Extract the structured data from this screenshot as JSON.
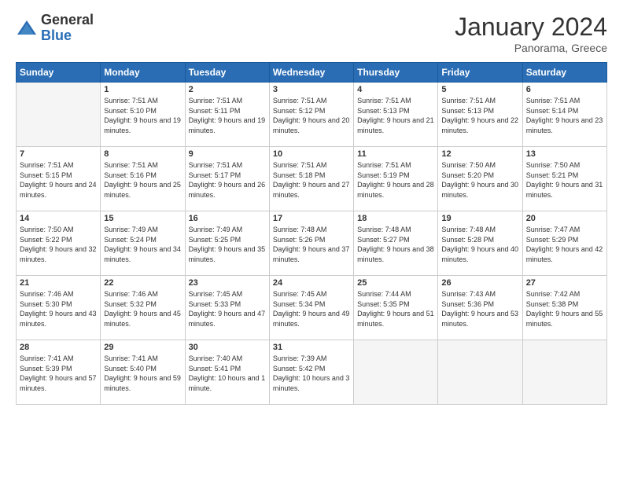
{
  "logo": {
    "general": "General",
    "blue": "Blue"
  },
  "header": {
    "title": "January 2024",
    "subtitle": "Panorama, Greece"
  },
  "days_of_week": [
    "Sunday",
    "Monday",
    "Tuesday",
    "Wednesday",
    "Thursday",
    "Friday",
    "Saturday"
  ],
  "weeks": [
    [
      {
        "day": "",
        "sunrise": "",
        "sunset": "",
        "daylight": "",
        "empty": true
      },
      {
        "day": "1",
        "sunrise": "Sunrise: 7:51 AM",
        "sunset": "Sunset: 5:10 PM",
        "daylight": "Daylight: 9 hours and 19 minutes."
      },
      {
        "day": "2",
        "sunrise": "Sunrise: 7:51 AM",
        "sunset": "Sunset: 5:11 PM",
        "daylight": "Daylight: 9 hours and 19 minutes."
      },
      {
        "day": "3",
        "sunrise": "Sunrise: 7:51 AM",
        "sunset": "Sunset: 5:12 PM",
        "daylight": "Daylight: 9 hours and 20 minutes."
      },
      {
        "day": "4",
        "sunrise": "Sunrise: 7:51 AM",
        "sunset": "Sunset: 5:13 PM",
        "daylight": "Daylight: 9 hours and 21 minutes."
      },
      {
        "day": "5",
        "sunrise": "Sunrise: 7:51 AM",
        "sunset": "Sunset: 5:13 PM",
        "daylight": "Daylight: 9 hours and 22 minutes."
      },
      {
        "day": "6",
        "sunrise": "Sunrise: 7:51 AM",
        "sunset": "Sunset: 5:14 PM",
        "daylight": "Daylight: 9 hours and 23 minutes."
      }
    ],
    [
      {
        "day": "7",
        "sunrise": "Sunrise: 7:51 AM",
        "sunset": "Sunset: 5:15 PM",
        "daylight": "Daylight: 9 hours and 24 minutes."
      },
      {
        "day": "8",
        "sunrise": "Sunrise: 7:51 AM",
        "sunset": "Sunset: 5:16 PM",
        "daylight": "Daylight: 9 hours and 25 minutes."
      },
      {
        "day": "9",
        "sunrise": "Sunrise: 7:51 AM",
        "sunset": "Sunset: 5:17 PM",
        "daylight": "Daylight: 9 hours and 26 minutes."
      },
      {
        "day": "10",
        "sunrise": "Sunrise: 7:51 AM",
        "sunset": "Sunset: 5:18 PM",
        "daylight": "Daylight: 9 hours and 27 minutes."
      },
      {
        "day": "11",
        "sunrise": "Sunrise: 7:51 AM",
        "sunset": "Sunset: 5:19 PM",
        "daylight": "Daylight: 9 hours and 28 minutes."
      },
      {
        "day": "12",
        "sunrise": "Sunrise: 7:50 AM",
        "sunset": "Sunset: 5:20 PM",
        "daylight": "Daylight: 9 hours and 30 minutes."
      },
      {
        "day": "13",
        "sunrise": "Sunrise: 7:50 AM",
        "sunset": "Sunset: 5:21 PM",
        "daylight": "Daylight: 9 hours and 31 minutes."
      }
    ],
    [
      {
        "day": "14",
        "sunrise": "Sunrise: 7:50 AM",
        "sunset": "Sunset: 5:22 PM",
        "daylight": "Daylight: 9 hours and 32 minutes."
      },
      {
        "day": "15",
        "sunrise": "Sunrise: 7:49 AM",
        "sunset": "Sunset: 5:24 PM",
        "daylight": "Daylight: 9 hours and 34 minutes."
      },
      {
        "day": "16",
        "sunrise": "Sunrise: 7:49 AM",
        "sunset": "Sunset: 5:25 PM",
        "daylight": "Daylight: 9 hours and 35 minutes."
      },
      {
        "day": "17",
        "sunrise": "Sunrise: 7:48 AM",
        "sunset": "Sunset: 5:26 PM",
        "daylight": "Daylight: 9 hours and 37 minutes."
      },
      {
        "day": "18",
        "sunrise": "Sunrise: 7:48 AM",
        "sunset": "Sunset: 5:27 PM",
        "daylight": "Daylight: 9 hours and 38 minutes."
      },
      {
        "day": "19",
        "sunrise": "Sunrise: 7:48 AM",
        "sunset": "Sunset: 5:28 PM",
        "daylight": "Daylight: 9 hours and 40 minutes."
      },
      {
        "day": "20",
        "sunrise": "Sunrise: 7:47 AM",
        "sunset": "Sunset: 5:29 PM",
        "daylight": "Daylight: 9 hours and 42 minutes."
      }
    ],
    [
      {
        "day": "21",
        "sunrise": "Sunrise: 7:46 AM",
        "sunset": "Sunset: 5:30 PM",
        "daylight": "Daylight: 9 hours and 43 minutes."
      },
      {
        "day": "22",
        "sunrise": "Sunrise: 7:46 AM",
        "sunset": "Sunset: 5:32 PM",
        "daylight": "Daylight: 9 hours and 45 minutes."
      },
      {
        "day": "23",
        "sunrise": "Sunrise: 7:45 AM",
        "sunset": "Sunset: 5:33 PM",
        "daylight": "Daylight: 9 hours and 47 minutes."
      },
      {
        "day": "24",
        "sunrise": "Sunrise: 7:45 AM",
        "sunset": "Sunset: 5:34 PM",
        "daylight": "Daylight: 9 hours and 49 minutes."
      },
      {
        "day": "25",
        "sunrise": "Sunrise: 7:44 AM",
        "sunset": "Sunset: 5:35 PM",
        "daylight": "Daylight: 9 hours and 51 minutes."
      },
      {
        "day": "26",
        "sunrise": "Sunrise: 7:43 AM",
        "sunset": "Sunset: 5:36 PM",
        "daylight": "Daylight: 9 hours and 53 minutes."
      },
      {
        "day": "27",
        "sunrise": "Sunrise: 7:42 AM",
        "sunset": "Sunset: 5:38 PM",
        "daylight": "Daylight: 9 hours and 55 minutes."
      }
    ],
    [
      {
        "day": "28",
        "sunrise": "Sunrise: 7:41 AM",
        "sunset": "Sunset: 5:39 PM",
        "daylight": "Daylight: 9 hours and 57 minutes."
      },
      {
        "day": "29",
        "sunrise": "Sunrise: 7:41 AM",
        "sunset": "Sunset: 5:40 PM",
        "daylight": "Daylight: 9 hours and 59 minutes."
      },
      {
        "day": "30",
        "sunrise": "Sunrise: 7:40 AM",
        "sunset": "Sunset: 5:41 PM",
        "daylight": "Daylight: 10 hours and 1 minute."
      },
      {
        "day": "31",
        "sunrise": "Sunrise: 7:39 AM",
        "sunset": "Sunset: 5:42 PM",
        "daylight": "Daylight: 10 hours and 3 minutes."
      },
      {
        "day": "",
        "sunrise": "",
        "sunset": "",
        "daylight": "",
        "empty": true
      },
      {
        "day": "",
        "sunrise": "",
        "sunset": "",
        "daylight": "",
        "empty": true
      },
      {
        "day": "",
        "sunrise": "",
        "sunset": "",
        "daylight": "",
        "empty": true
      }
    ]
  ]
}
